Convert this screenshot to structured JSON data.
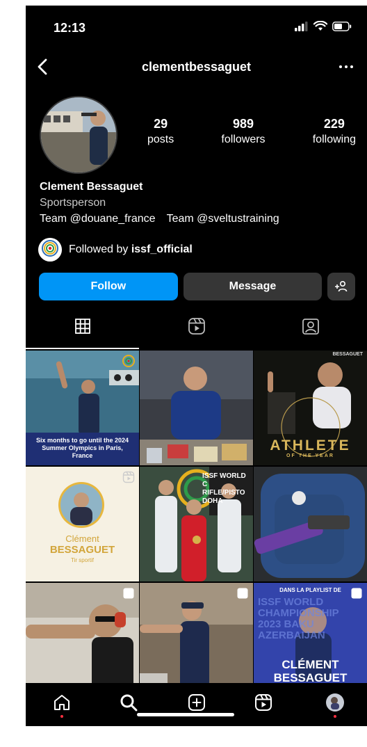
{
  "status": {
    "time": "12:13"
  },
  "header": {
    "username": "clementbessaguet"
  },
  "stats": [
    {
      "value": "29",
      "label": "posts"
    },
    {
      "value": "989",
      "label": "followers"
    },
    {
      "value": "229",
      "label": "following"
    }
  ],
  "bio": {
    "name": "Clement Bessaguet",
    "category": "Sportsperson",
    "links": [
      "Team @douane_france",
      "Team @sveltustraining"
    ]
  },
  "followed_by": {
    "prefix": "Followed by ",
    "account": "issf_official",
    "logo_text": "ISSF"
  },
  "buttons": {
    "follow": "Follow",
    "message": "Message"
  },
  "posts": {
    "p1_text": "Six months to go until the 2024 Summer Olympics in Paris, France",
    "p3_title": "ATHLETE",
    "p3_sub": "OF THE YEAR",
    "p3_top": "BESSAGUET",
    "p4_line1": "Clément",
    "p4_line2": "BESSAGUET",
    "p4_line3": "Tir sportif",
    "p5_banner": "ISSF WORLD C RIFLE/PISTO DOHA",
    "p9_top": "DANS LA PLAYLIST DE",
    "p9_bg": "ISSF WORLD CHAMPIONSHIP 2023 BAKU AZERBAIJAN",
    "p9_name1": "CLÉMENT",
    "p9_name2": "BESSAGUET"
  },
  "colors": {
    "accent": "#0095f6",
    "secondary_button": "#363636",
    "notification": "#ff3040"
  }
}
